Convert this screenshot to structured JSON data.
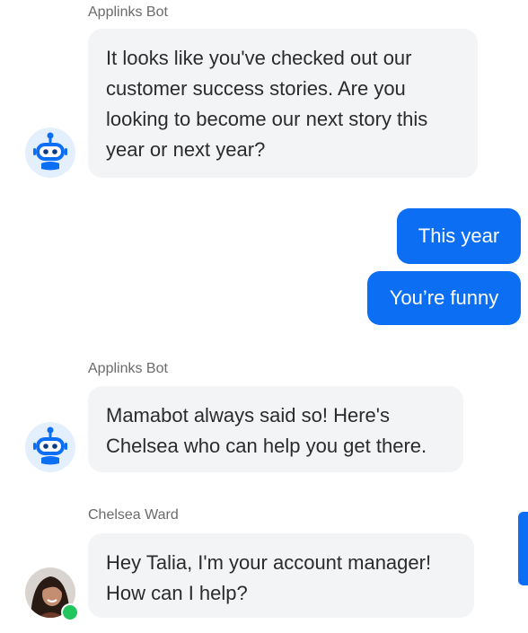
{
  "colors": {
    "brand_blue": "#0b6ef3",
    "bot_bubble": "#f3f4f6",
    "online": "#22c55e"
  },
  "messages": {
    "m1": {
      "sender": "Applinks Bot",
      "lines": [
        "It looks like you've checked out our",
        "customer success stories. Are you",
        "looking to become our next story this",
        "year or next year?"
      ],
      "avatar_icon": "robot-icon"
    },
    "reply1": {
      "text": "This year"
    },
    "reply2": {
      "text": "You’re funny"
    },
    "m2": {
      "sender": "Applinks Bot",
      "lines": [
        "Mamabot always said so! Here's",
        "Chelsea who can help you get there."
      ],
      "avatar_icon": "robot-icon"
    },
    "m3": {
      "sender": "Chelsea Ward",
      "lines": [
        "Hey Talia, I'm your account manager!",
        "How can I help?"
      ],
      "avatar_status": "online"
    }
  }
}
